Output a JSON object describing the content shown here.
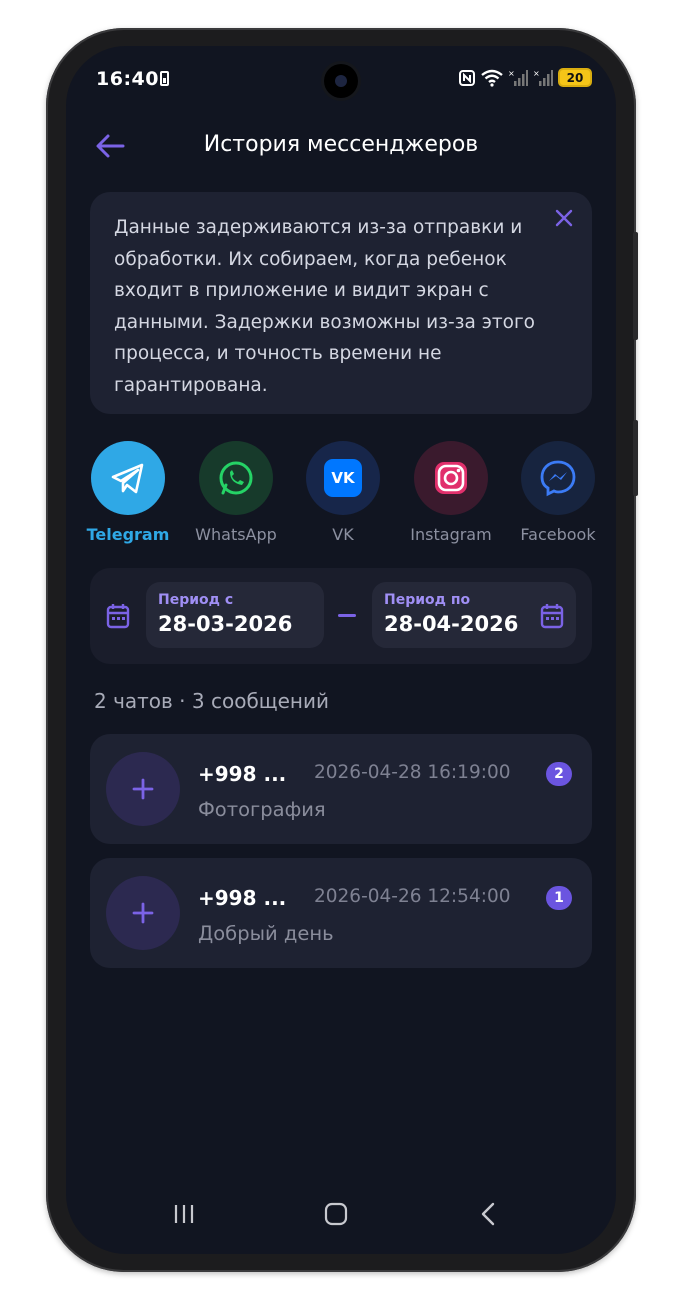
{
  "status_bar": {
    "time": "16:40",
    "battery_level": "20"
  },
  "header": {
    "title": "История мессенджеров"
  },
  "info_card": {
    "text": "Данные задерживаются из-за отправки и обработки. Их собираем, когда ребенок входит в приложение и видит экран с данными. Задержки возможны из-за этого процесса, и точность времени не гарантирована."
  },
  "messengers": [
    {
      "label": "Telegram",
      "active": true,
      "color": "#2fa8e6",
      "icon": "telegram-icon"
    },
    {
      "label": "WhatsApp",
      "active": false,
      "color": "#25d366",
      "icon": "whatsapp-icon"
    },
    {
      "label": "VK",
      "active": false,
      "color": "#0077ff",
      "icon": "vk-icon"
    },
    {
      "label": "Instagram",
      "active": false,
      "color": "#e1306c",
      "icon": "instagram-icon"
    },
    {
      "label": "Facebook",
      "active": false,
      "color": "#3b7bf5",
      "icon": "messenger-icon"
    }
  ],
  "date_filter": {
    "from_label": "Период с",
    "from_value": "28-03-2026",
    "to_label": "Период по",
    "to_value": "28-04-2026"
  },
  "summary": "2 чатов · 3 сообщений",
  "chats": [
    {
      "name": "+998 ...",
      "time": "2026-04-28 16:19:00",
      "preview": "Фотография",
      "count": "2"
    },
    {
      "name": "+998 ...",
      "time": "2026-04-26 12:54:00",
      "preview": "Добрый день",
      "count": "1"
    }
  ],
  "colors": {
    "background": "#111521",
    "card": "#1e2232",
    "accent": "#7b63e6",
    "telegram_blue": "#2fa8e6"
  }
}
